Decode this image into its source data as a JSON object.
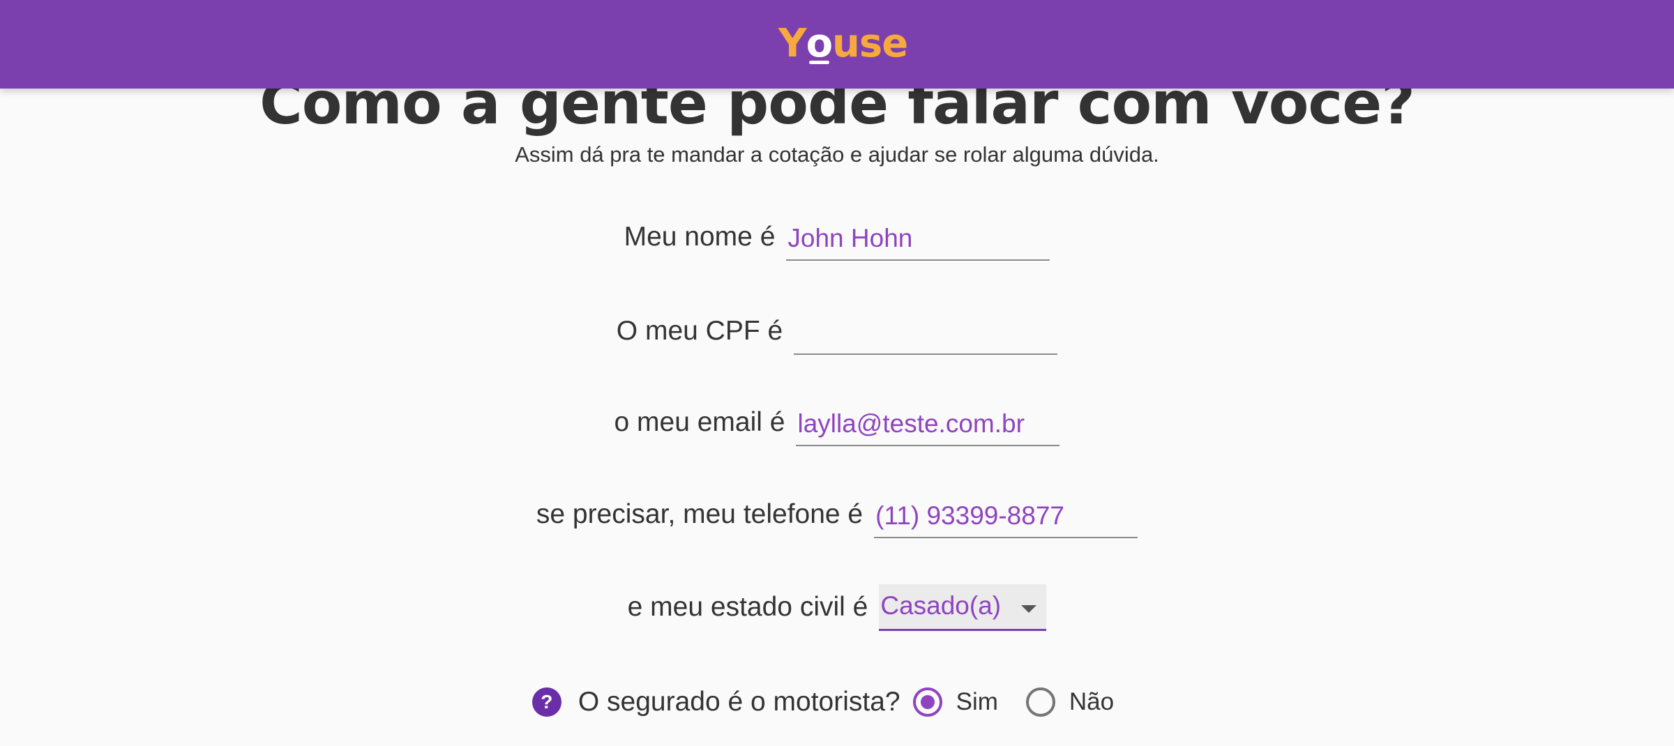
{
  "header": {
    "logo_left": "Y",
    "logo_o": "o",
    "logo_right": "use"
  },
  "page": {
    "title": "Como a gente pode falar com você?",
    "subtitle": "Assim dá pra te mandar a cotação e ajudar se rolar alguma dúvida."
  },
  "form": {
    "name": {
      "label": "Meu nome é",
      "value": "John Hohn"
    },
    "cpf": {
      "label": "O meu CPF é",
      "value": ""
    },
    "email": {
      "label": "o meu email é",
      "value": "laylla@teste.com.br"
    },
    "phone": {
      "label": "se precisar, meu telefone é",
      "value": "(11) 93399-8877"
    },
    "civil_status": {
      "label": "e meu estado civil é",
      "selected": "Casado(a)"
    },
    "driver": {
      "help_icon": "?",
      "question": "O segurado é o motorista?",
      "options": [
        {
          "label": "Sim",
          "selected": true
        },
        {
          "label": "Não",
          "selected": false
        }
      ]
    }
  },
  "colors": {
    "header": "#7b3fae",
    "accent": "#8e44bf",
    "logo": "#f8a93d"
  }
}
